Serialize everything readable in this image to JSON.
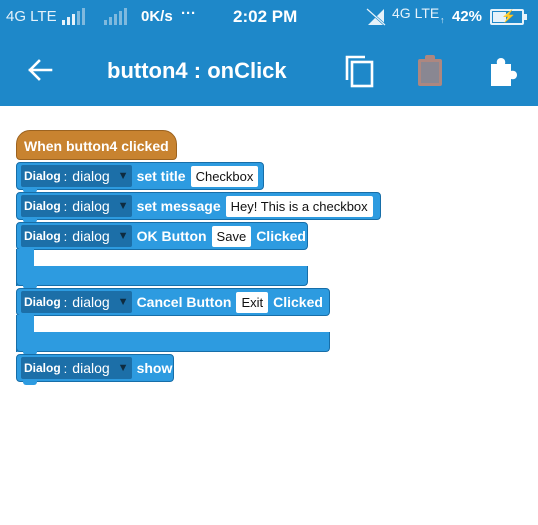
{
  "status_bar": {
    "network_left": "4G LTE",
    "speed": "0K/s",
    "more_dots": "···",
    "time": "2:02 PM",
    "network_right": "4G LTE",
    "battery_percent": "42%",
    "battery_level": 0.42
  },
  "app_bar": {
    "title": "button4 : onClick",
    "icons": [
      "arrow-back-icon",
      "copy-icon",
      "clipboard-icon",
      "puzzle-icon"
    ]
  },
  "blocks": {
    "event": "When button4 clicked",
    "set_title": {
      "cls": "Dialog",
      "colon": ":",
      "var": "dialog",
      "label": "set title",
      "value": "Checkbox"
    },
    "set_message": {
      "cls": "Dialog",
      "colon": ":",
      "var": "dialog",
      "label": "set message",
      "value": "Hey!  This is a checkbox"
    },
    "ok_button": {
      "cls": "Dialog",
      "colon": ":",
      "var": "dialog",
      "label": "OK Button",
      "value": "Save",
      "suffix": "Clicked"
    },
    "cancel_button": {
      "cls": "Dialog",
      "colon": ":",
      "var": "dialog",
      "label": "Cancel Button",
      "value": "Exit",
      "suffix": "Clicked"
    },
    "show": {
      "cls": "Dialog",
      "colon": ":",
      "var": "dialog",
      "label": "show"
    }
  },
  "colors": {
    "primary": "#1e88c9",
    "event_block": "#c88330",
    "method_block": "#2d9be0",
    "object_chip": "#1c6fa8",
    "clipboard_disabled": "#ad8780"
  }
}
